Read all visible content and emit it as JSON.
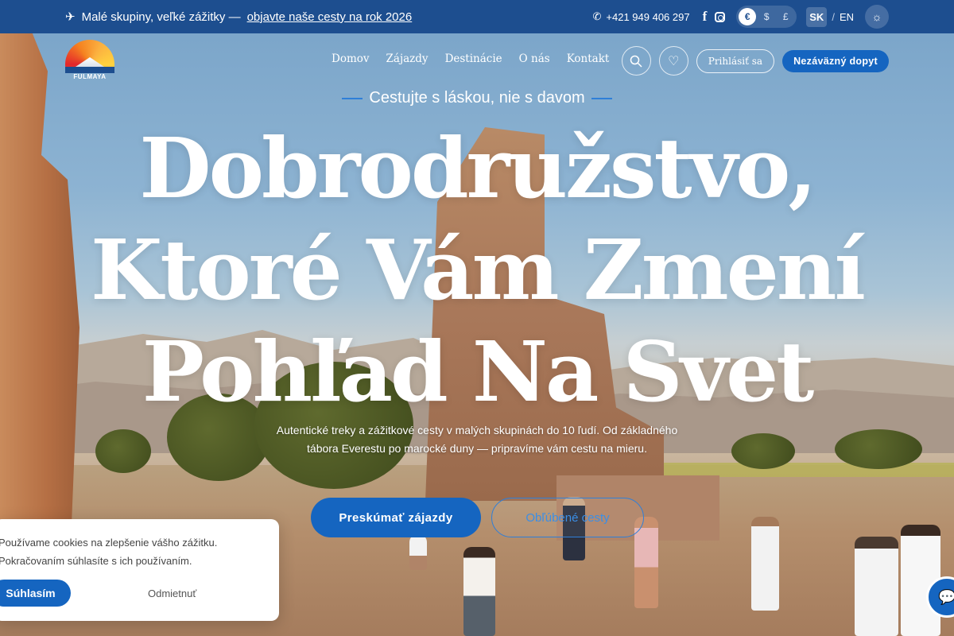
{
  "topbar": {
    "promo_text": "Malé skupiny, veľké zážitky —",
    "promo_link": "objavte naše cesty na rok 2026",
    "phone": "+421 949 406 297",
    "currencies": [
      "€",
      "$",
      "£"
    ],
    "active_currency": "€",
    "languages": [
      "SK",
      "EN"
    ],
    "lang_separator": "/"
  },
  "logo": {
    "name": "FULMAYA"
  },
  "nav": {
    "items": [
      "Domov",
      "Zájazdy",
      "Destinácie",
      "O nás",
      "Kontakt"
    ],
    "login_label": "Prihlásiť sa",
    "inquiry_label": "Nezáväzný dopyt"
  },
  "hero": {
    "tagline": "Cestujte s láskou, nie s davom",
    "headline": "Dobrodružstvo, Ktoré Vám Zmení Pohľad Na Svet",
    "subtitle": "Autentické treky a zážitkové cesty v malých skupinách do 10 ľudí. Od základného tábora Everestu po marocké duny — pripravíme vám cestu na mieru.",
    "primary_cta": "Preskúmať zájazdy",
    "secondary_cta": "Obľúbené cesty"
  },
  "cookie": {
    "line1": "Používame cookies na zlepšenie vášho zážitku.",
    "line2": "Pokračovaním súhlasíte s ich používaním.",
    "accept": "Súhlasím",
    "decline": "Odmietnuť"
  },
  "icons": {
    "promo": "paper-plane-icon",
    "phone": "phone-icon",
    "facebook": "facebook-icon",
    "instagram": "instagram-icon",
    "theme": "sun-icon",
    "search": "search-icon",
    "favorites": "heart-icon",
    "chat": "chat-icon"
  },
  "colors": {
    "primary": "#1565c0",
    "topbar": "#1d4e8f",
    "accent_line": "#2f7fd8"
  }
}
